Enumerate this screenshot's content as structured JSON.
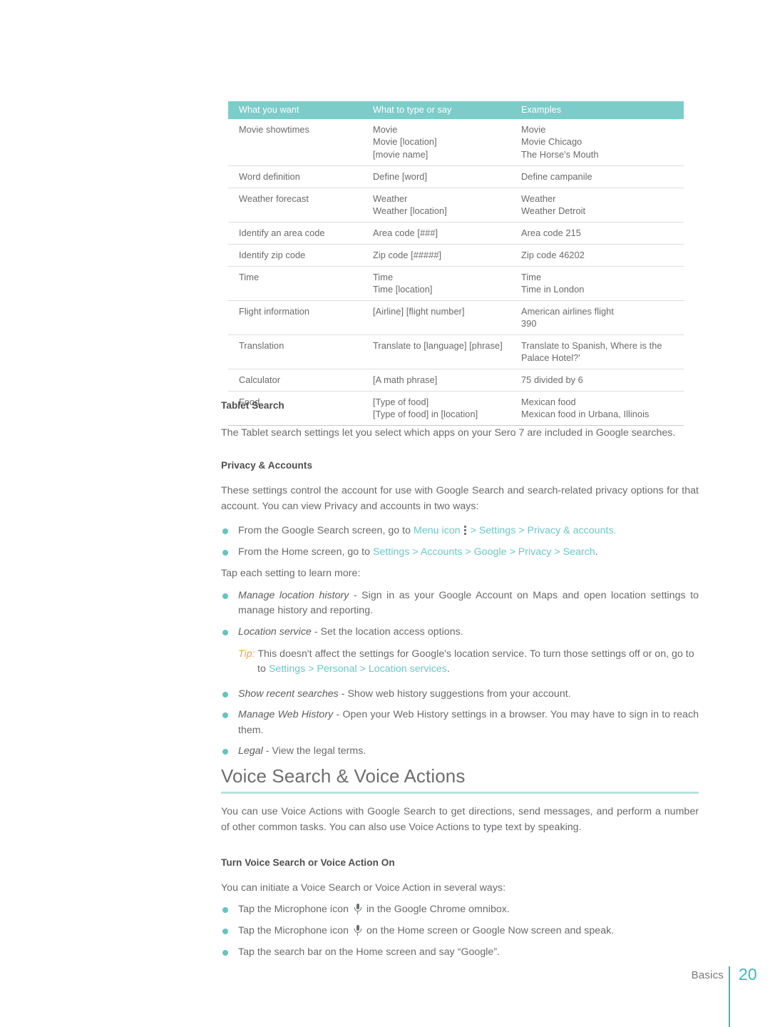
{
  "table": {
    "headers": [
      "What you want",
      "What to type or say",
      "Examples"
    ],
    "rows": [
      {
        "want": [
          "Movie showtimes"
        ],
        "type": [
          "Movie",
          "Movie [location]",
          "[movie name]"
        ],
        "examples": [
          "Movie",
          "Movie Chicago",
          "The Horse's Mouth"
        ]
      },
      {
        "want": [
          "Word definition"
        ],
        "type": [
          "Define [word]"
        ],
        "examples": [
          "Define campanile"
        ]
      },
      {
        "want": [
          "Weather forecast"
        ],
        "type": [
          "Weather",
          "Weather [location]"
        ],
        "examples": [
          "Weather",
          "Weather Detroit"
        ]
      },
      {
        "want": [
          "Identify an area code"
        ],
        "type": [
          "Area code [###]"
        ],
        "examples": [
          "Area code 215"
        ]
      },
      {
        "want": [
          "Identify zip code"
        ],
        "type": [
          "Zip code [#####]"
        ],
        "examples": [
          "Zip code 46202"
        ]
      },
      {
        "want": [
          "Time"
        ],
        "type": [
          "Time",
          "Time [location]"
        ],
        "examples": [
          "Time",
          "Time in London"
        ]
      },
      {
        "want": [
          "Flight information"
        ],
        "type": [
          "[Airline] [flight number]"
        ],
        "examples": [
          "American airlines flight",
          "390"
        ]
      },
      {
        "want": [
          "Translation"
        ],
        "type": [
          "Translate to [language] [phrase]"
        ],
        "examples": [
          "Translate to Spanish, Where is the",
          "Palace Hotel?'"
        ]
      },
      {
        "want": [
          "Calculator"
        ],
        "type": [
          "[A math phrase]"
        ],
        "examples": [
          "75 divided by 6"
        ]
      },
      {
        "want": [
          "Food"
        ],
        "type": [
          "[Type of food]",
          "[Type of food] in [location]"
        ],
        "examples": [
          "Mexican food",
          "Mexican food in Urbana, Illinois"
        ]
      }
    ]
  },
  "tablet_search": {
    "heading": "Tablet Search",
    "body": "The Tablet search settings let you select which apps on your Sero 7 are included in Google searches."
  },
  "privacy": {
    "heading": "Privacy & Accounts",
    "body": "These settings control the account for use with Google Search and search-related privacy options for that account. You can view Privacy and accounts in two ways:",
    "bullet1_pre": "From the Google Search screen, go to ",
    "bullet1_link_a": "Menu icon",
    "bullet1_link_b": "> Settings > Privacy & accounts.",
    "bullet2_pre": "From the Home screen, go to ",
    "bullet2_link": "Settings > Accounts > Google > Privacy > Search",
    "bullet2_post": ".",
    "tap_each": "Tap each setting to learn more:",
    "settings": [
      {
        "term": "Manage location history",
        "desc": " - Sign in as your Google Account on Maps and open location settings to manage history and reporting."
      },
      {
        "term": "Location service",
        "desc": " - Set the location access options."
      }
    ],
    "tip_label": "Tip:",
    "tip_text": " This doesn't affect the settings for Google's location service. To turn those settings off or on, go to ",
    "tip_link": "Settings > Personal > Location services",
    "tip_post": ".",
    "settings2": [
      {
        "term": "Show recent searches",
        "desc": " - Show web history suggestions from your account."
      },
      {
        "term": "Manage Web History",
        "desc": " - Open your Web History settings in a browser. You may have to sign in to reach them."
      },
      {
        "term": "Legal",
        "desc": " - View the legal terms."
      }
    ]
  },
  "voice": {
    "heading": "Voice Search & Voice Actions",
    "body": "You can use Voice Actions with Google Search to get directions, send messages, and perform a number of other common tasks. You can also use Voice Actions to type text by speaking.",
    "sub_heading": "Turn Voice Search or Voice Action On",
    "sub_body": "You can initiate a Voice Search or Voice Action in several ways:",
    "bullet1_pre": "Tap the Microphone icon ",
    "bullet1_post": " in the Google Chrome omnibox.",
    "bullet2_pre": "Tap the Microphone icon ",
    "bullet2_post": " on the Home screen or Google Now screen and speak.",
    "bullet3": "Tap the search bar on the Home screen and say “Google”."
  },
  "footer": {
    "section": "Basics",
    "page": "20"
  },
  "colors": {
    "table_header_bg": "#7ccdc9",
    "link_teal": "#6ac9c4",
    "bullet_teal": "#62c5c0",
    "rule_teal": "#b9e2de",
    "page_teal": "#31bfb9",
    "tip_orange": "#f0a04b",
    "body_gray": "#6a6a6c"
  }
}
